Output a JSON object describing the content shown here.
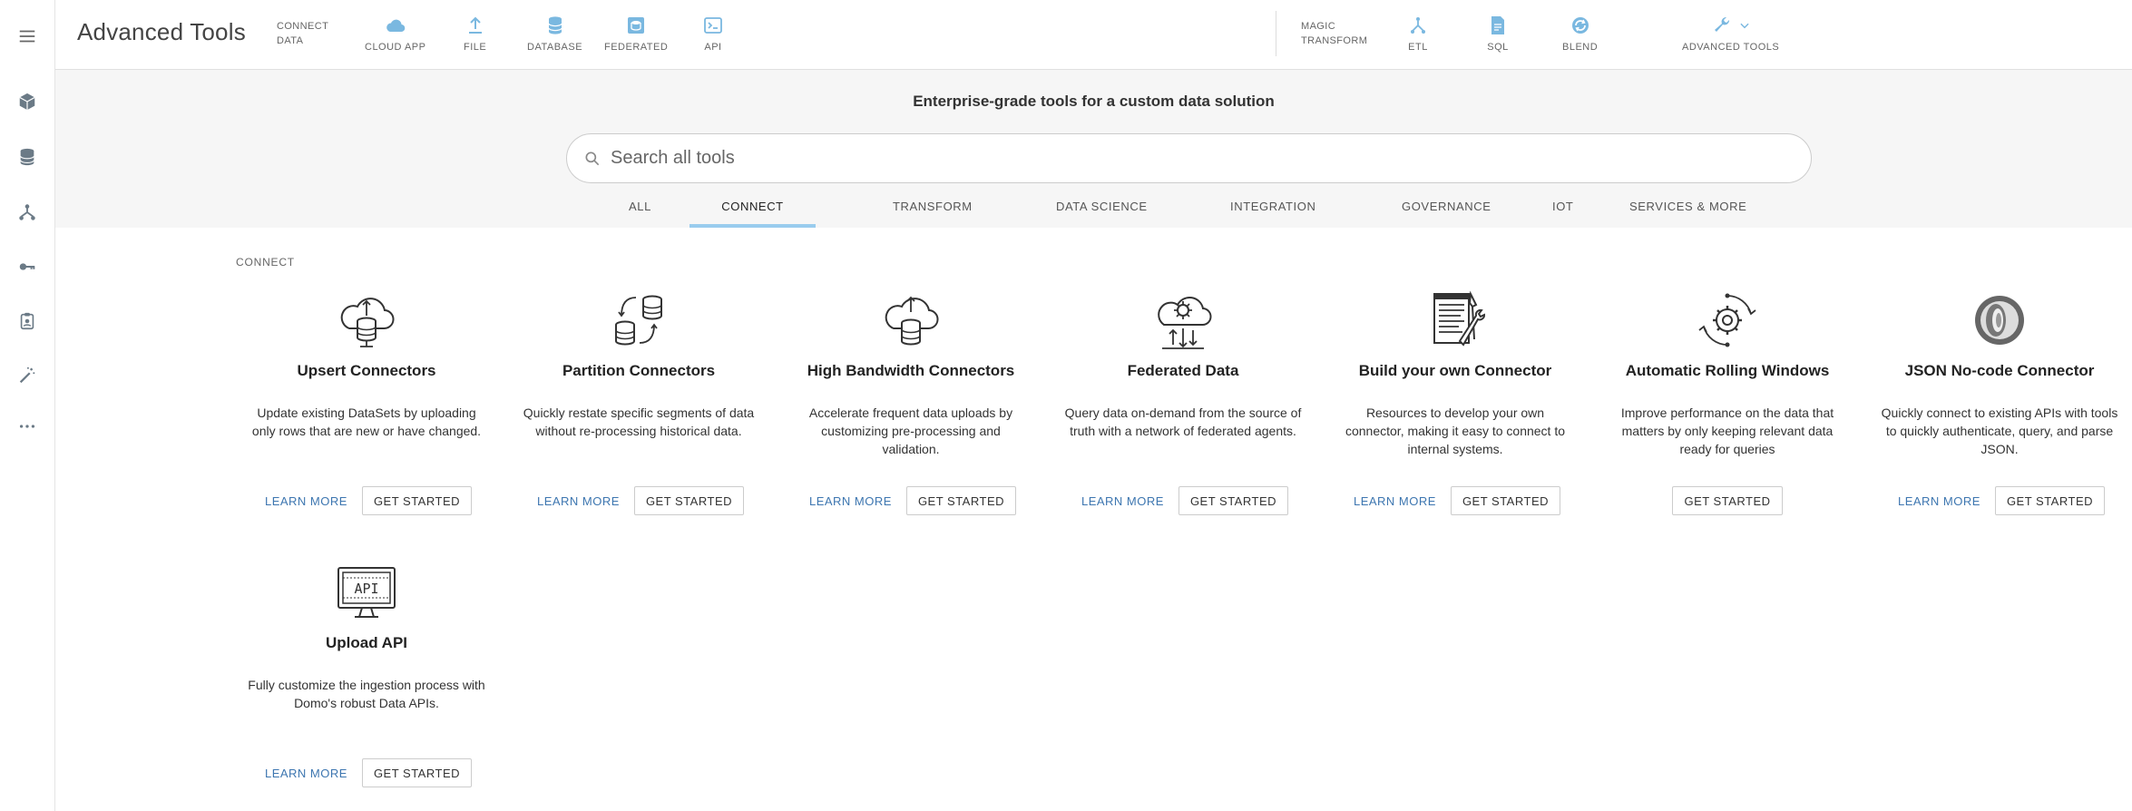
{
  "app": {
    "title": "Advanced Tools"
  },
  "connect_group": {
    "line1": "CONNECT",
    "line2": "DATA"
  },
  "connect_tools": [
    {
      "label": "CLOUD APP",
      "icon": "cloud-icon"
    },
    {
      "label": "FILE",
      "icon": "upload-icon"
    },
    {
      "label": "DATABASE",
      "icon": "database-icon"
    },
    {
      "label": "FEDERATED",
      "icon": "federated-icon"
    },
    {
      "label": "API",
      "icon": "terminal-icon"
    }
  ],
  "transform_group": {
    "line1": "MAGIC",
    "line2": "TRANSFORM"
  },
  "transform_tools": [
    {
      "label": "ETL",
      "icon": "etl-icon"
    },
    {
      "label": "SQL",
      "icon": "sql-icon"
    },
    {
      "label": "BLEND",
      "icon": "blend-icon"
    },
    {
      "label": "ADVANCED TOOLS",
      "icon": "wrench-icon"
    }
  ],
  "hero": {
    "tagline": "Enterprise-grade tools for a custom data solution",
    "search_placeholder": "Search all tools"
  },
  "tabs": [
    {
      "label": "ALL"
    },
    {
      "label": "CONNECT",
      "active": true
    },
    {
      "label": "TRANSFORM"
    },
    {
      "label": "DATA SCIENCE"
    },
    {
      "label": "INTEGRATION"
    },
    {
      "label": "GOVERNANCE"
    },
    {
      "label": "IOT"
    },
    {
      "label": "SERVICES & MORE"
    }
  ],
  "section": {
    "label": "CONNECT"
  },
  "actions": {
    "learn_more": "LEARN MORE",
    "get_started": "GET STARTED"
  },
  "cards": [
    {
      "title": "Upsert Connectors",
      "desc": "Update existing DataSets by uploading only rows that are new or have changed.",
      "icon": "cloud-database-upsert-icon",
      "learn": true
    },
    {
      "title": "Partition Connectors",
      "desc": "Quickly restate specific segments of data without re-processing historical data.",
      "icon": "database-partition-icon",
      "learn": true
    },
    {
      "title": "High Bandwidth Connectors",
      "desc": "Accelerate frequent data uploads by customizing pre-processing and validation.",
      "icon": "cloud-database-bandwidth-icon",
      "learn": true
    },
    {
      "title": "Federated Data",
      "desc": "Query data on-demand from the source of truth with a network of federated agents.",
      "icon": "cloud-gear-federated-icon",
      "learn": true
    },
    {
      "title": "Build your own Connector",
      "desc": "Resources to develop your own connector, making it easy to connect to internal systems.",
      "icon": "document-tools-icon",
      "learn": true
    },
    {
      "title": "Automatic Rolling Windows",
      "desc": "Improve performance on the data that matters by only keeping relevant data ready for queries",
      "icon": "gear-cycle-icon",
      "learn": false
    },
    {
      "title": "JSON No-code Connector",
      "desc": "Quickly connect to existing APIs with tools to quickly authenticate, query, and parse JSON.",
      "icon": "json-rings-icon",
      "learn": true
    },
    {
      "title": "Upload API",
      "desc": "Fully customize the ingestion process with Domo's robust Data APIs.",
      "icon": "api-monitor-icon",
      "learn": true
    }
  ],
  "colors": {
    "accent": "#3d76b0",
    "tab_underline": "#99ccee",
    "icon_blue": "#7ab8e0",
    "rail_icon": "#6b7a86"
  }
}
